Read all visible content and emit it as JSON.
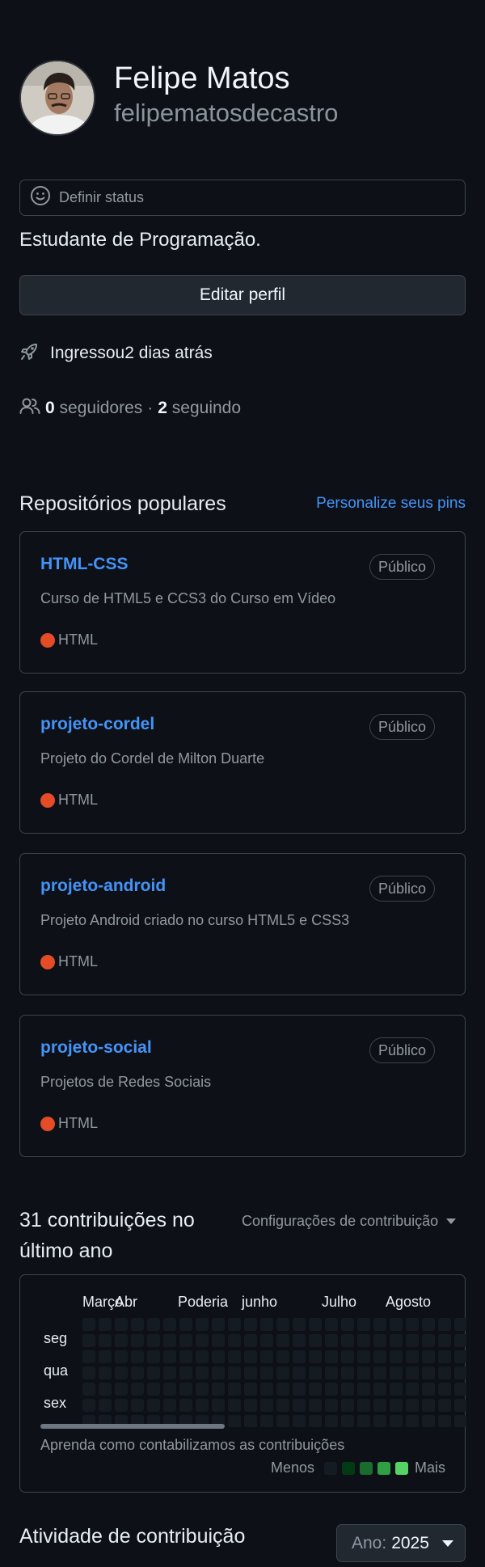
{
  "profile": {
    "name": "Felipe Matos",
    "username": "felipematosdecastro",
    "status_label": "Definir status",
    "bio": "Estudante de Programação.",
    "edit_label": "Editar perfil",
    "joined": "Ingressou2 dias atrás",
    "followers_count": "0",
    "followers_label": "seguidores",
    "separator": "·",
    "following_count": "2",
    "following_label": "seguindo"
  },
  "repos_section": {
    "title": "Repositórios populares",
    "customize_link": "Personalize seus pins",
    "repos": [
      {
        "name": "HTML-CSS",
        "visibility": "Público",
        "description": "Curso de HTML5 e CCS3 do Curso em Vídeo",
        "language": "HTML",
        "language_color": "#e34c26"
      },
      {
        "name": "projeto-cordel",
        "visibility": "Público",
        "description": "Projeto do Cordel de Milton Duarte",
        "language": "HTML",
        "language_color": "#e34c26"
      },
      {
        "name": "projeto-android",
        "visibility": "Público",
        "description": "Projeto Android criado no curso HTML5 e CSS3",
        "language": "HTML",
        "language_color": "#e34c26"
      },
      {
        "name": "projeto-social",
        "visibility": "Público",
        "description": "Projetos de Redes Sociais",
        "language": "HTML",
        "language_color": "#e34c26"
      }
    ]
  },
  "contributions": {
    "title": "31 contribuições no último ano",
    "settings_label": "Configurações de contribuição",
    "months": [
      "Março",
      "Abr",
      "Poderia",
      "junho",
      "Julho",
      "Agosto"
    ],
    "days": [
      "seg",
      "qua",
      "sex"
    ],
    "learn_link": "Aprenda como contabilizamos as contribuições",
    "legend_less": "Menos",
    "legend_more": "Mais",
    "legend_colors": [
      "#151b23",
      "#033a16",
      "#196c2e",
      "#2ea043",
      "#56d364"
    ],
    "empty_cell_color": "#151b23"
  },
  "activity": {
    "title": "Atividade de contribuição",
    "year_label": "Ano:",
    "year_value": "2025"
  }
}
